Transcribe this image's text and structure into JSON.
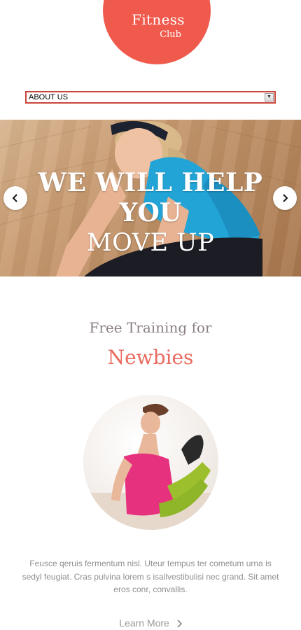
{
  "logo": {
    "title": "Fitness",
    "subtitle": "Club",
    "color": "#f05a4d"
  },
  "nav": {
    "selected": "ABOUT US"
  },
  "hero": {
    "line1": "WE WILL HELP",
    "line2": "YOU",
    "line3": "MOVE UP",
    "prev_icon": "chevron-left-icon",
    "next_icon": "chevron-right-icon"
  },
  "section": {
    "subtitle": "Free Training for",
    "title": "Newbies",
    "body": "Feusce qeruis fermentum nisl. Uteur tempus ter cometum urna is sedyl feugiat. Cras pulvina lorem s isallvestibulisi nec grand. Sit amet eros conr, convallis.",
    "link": "Learn More",
    "accent": "#ea6a5f"
  }
}
